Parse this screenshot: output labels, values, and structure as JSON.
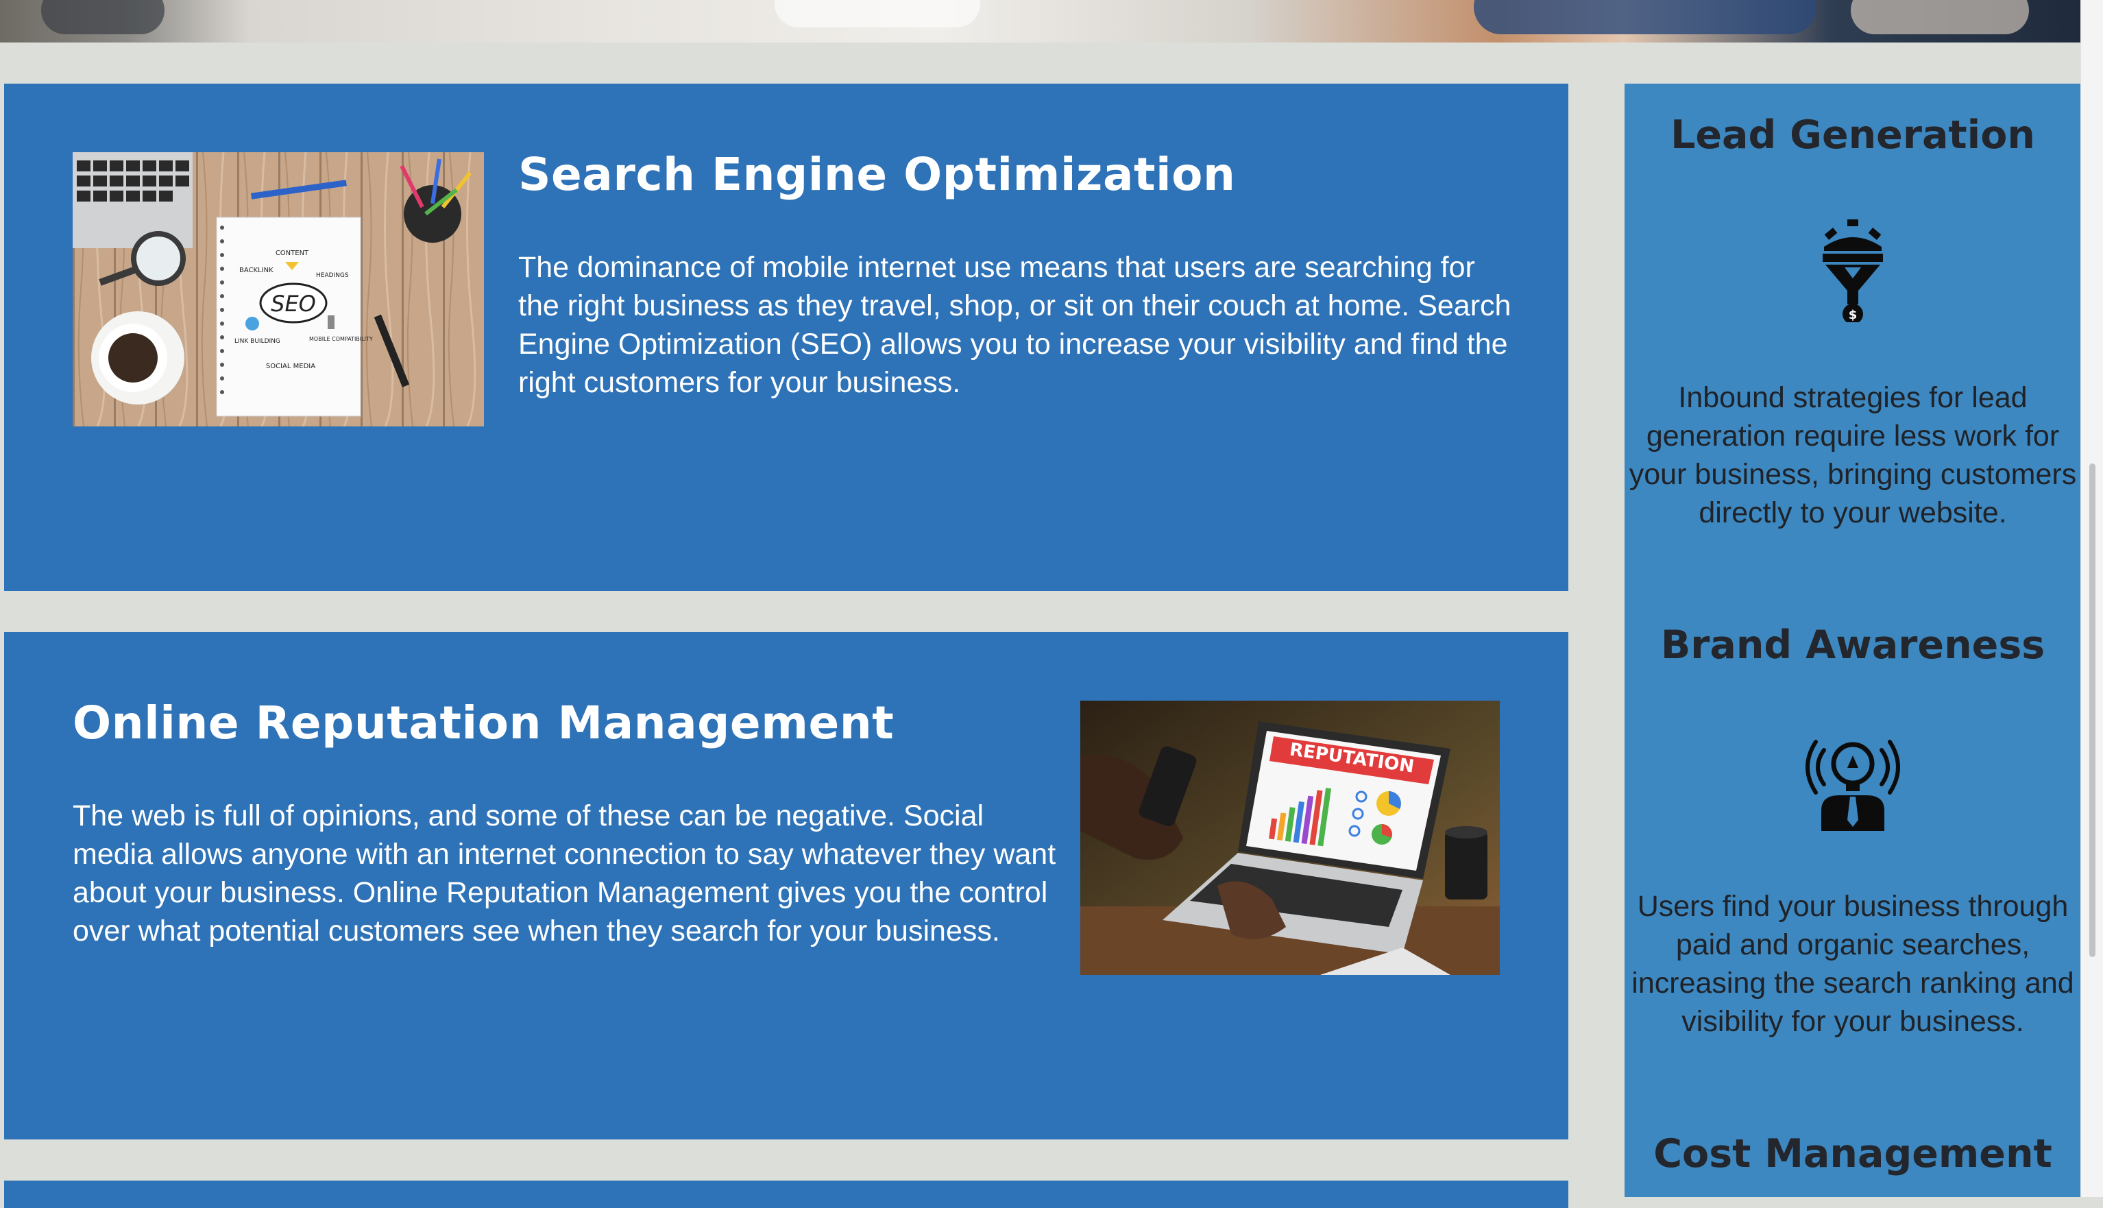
{
  "services": [
    {
      "title": "Search Engine Optimization",
      "body": "The dominance of mobile internet use means that users are searching for the right business as they travel, shop, or sit on their couch at home. Search Engine Optimization (SEO) allows you to increase your visibility and find the right customers for your business.",
      "image_labels": {
        "center": "SEO",
        "content": "CONTENT",
        "backlink": "BACKLINK",
        "headings": "HEADINGS",
        "link_building": "LINK BUILDING",
        "mobile": "MOBILE COMPATIBILITY",
        "social": "SOCIAL MEDIA"
      }
    },
    {
      "title": "Online Reputation Management",
      "body": "The web is full of opinions, and some of these can be negative. Social media allows anyone with an internet connection to say whatever they want about your business. Online Reputation Management gives you the control over what potential customers see when they search for your business.",
      "image_labels": {
        "screen_banner": "REPUTATION"
      }
    }
  ],
  "sidebar": {
    "items": [
      {
        "title": "Lead Generation",
        "icon": "funnel-gear-icon",
        "icon_glyph": "$",
        "body": "Inbound strategies for lead generation require less work for your business, bringing customers directly to your website."
      },
      {
        "title": "Brand Awareness",
        "icon": "idea-broadcast-icon",
        "body": "Users find your business through paid and organic searches, increasing the search ranking and visibility for your business."
      },
      {
        "title": "Cost Management"
      }
    ]
  },
  "colors": {
    "card_bg": "#2e72b7",
    "sidebar_bg": "#3d88c0",
    "page_bg": "#dcdfd9",
    "card_text": "#ffffff",
    "sidebar_text": "#1f2228"
  }
}
